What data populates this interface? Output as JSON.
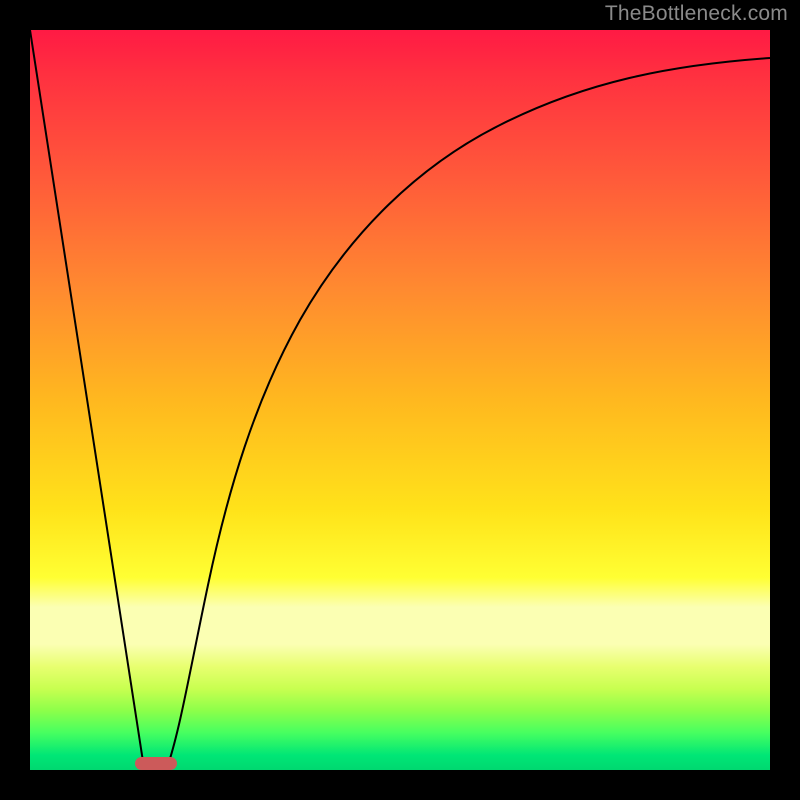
{
  "watermark": {
    "text": "TheBottleneck.com"
  },
  "chart_data": {
    "type": "line",
    "title": "",
    "xlabel": "",
    "ylabel": "",
    "xlim": [
      0,
      100
    ],
    "ylim": [
      0,
      100
    ],
    "grid": false,
    "legend": false,
    "annotations": [],
    "background_gradient": {
      "direction": "vertical",
      "stops": [
        {
          "pos": 0.0,
          "color": "#ff1a44"
        },
        {
          "pos": 0.35,
          "color": "#ff8a30"
        },
        {
          "pos": 0.65,
          "color": "#ffe31a"
        },
        {
          "pos": 0.8,
          "color": "#fbffb3"
        },
        {
          "pos": 1.0,
          "color": "#00d870"
        }
      ]
    },
    "series": [
      {
        "name": "left-edge",
        "kind": "line",
        "x": [
          0,
          15.5
        ],
        "y": [
          100,
          0
        ]
      },
      {
        "name": "right-curve",
        "kind": "line",
        "x": [
          18.5,
          20,
          22,
          24,
          27,
          30,
          34,
          38,
          43,
          48,
          55,
          62,
          70,
          80,
          90,
          100
        ],
        "y": [
          0,
          12,
          24,
          34,
          46,
          54,
          62,
          68,
          74,
          78,
          83,
          86,
          89,
          92,
          94.5,
          96
        ]
      }
    ],
    "marker": {
      "shape": "capsule",
      "x_center": 17,
      "y": 0,
      "width": 5,
      "height": 2,
      "color": "#cc5a5a"
    }
  }
}
